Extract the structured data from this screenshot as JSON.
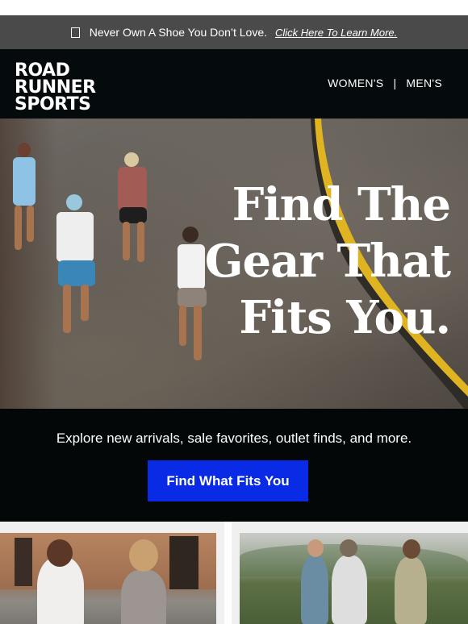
{
  "promo_bar": {
    "text": "Never Own A Shoe You Don’t Love.",
    "link": "Click Here To Learn More."
  },
  "header": {
    "logo_lines": [
      "ROAD",
      "RUNNER",
      "SPORTS"
    ],
    "nav": {
      "womens": "WOMEN'S",
      "separator": "|",
      "mens": "MEN'S"
    }
  },
  "hero": {
    "headline_lines": [
      "Find The",
      "Gear That",
      "Fits You."
    ]
  },
  "cta": {
    "text": "Explore new arrivals, sale favorites, outlet finds, and more.",
    "button": "Find What Fits You"
  },
  "colors": {
    "promo_bg": "#4a4a4a",
    "header_bg": "#050a0c",
    "cta_button": "#0a2be6",
    "road_line": "#e0b321"
  }
}
